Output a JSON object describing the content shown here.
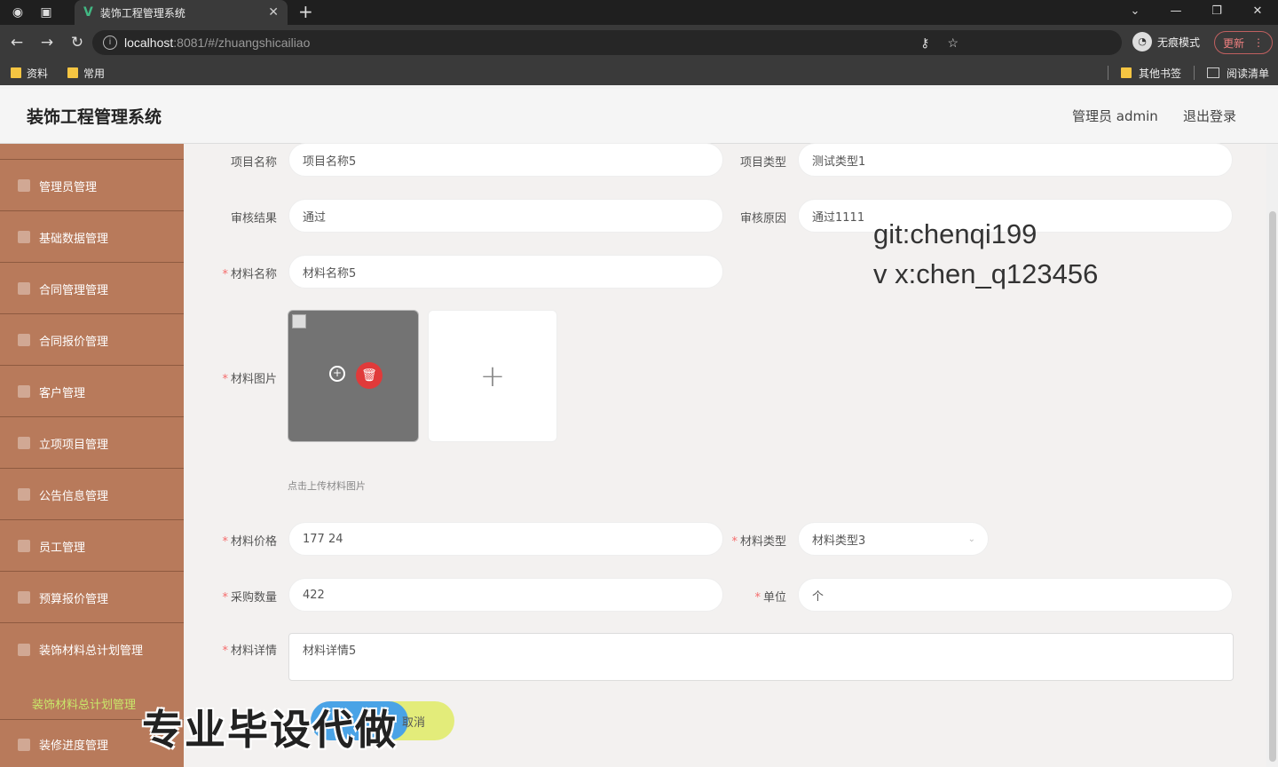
{
  "browser": {
    "tab_title": "装饰工程管理系统",
    "url_host": "localhost",
    "url_path": ":8081/#/zhuangshicailiao",
    "incognito_label": "无痕模式",
    "update_label": "更新",
    "bookmarks": [
      "资料",
      "常用"
    ],
    "bookmarks_right": [
      "其他书签",
      "阅读清单"
    ]
  },
  "header": {
    "title": "装饰工程管理系统",
    "user": "管理员 admin",
    "logout": "退出登录"
  },
  "sidebar": {
    "items": [
      {
        "label": "管理员管理"
      },
      {
        "label": "基础数据管理"
      },
      {
        "label": "合同管理管理"
      },
      {
        "label": "合同报价管理"
      },
      {
        "label": "客户管理"
      },
      {
        "label": "立项项目管理"
      },
      {
        "label": "公告信息管理"
      },
      {
        "label": "员工管理"
      },
      {
        "label": "预算报价管理"
      },
      {
        "label": "装饰材料总计划管理"
      }
    ],
    "active_sub": "装饰材料总计划管理",
    "last_item": "装修进度管理"
  },
  "form": {
    "project_name": {
      "label": "项目名称",
      "value": "项目名称5"
    },
    "project_type": {
      "label": "项目类型",
      "value": "测试类型1"
    },
    "review_result": {
      "label": "审核结果",
      "value": "通过"
    },
    "review_reason": {
      "label": "审核原因",
      "value": "通过1111"
    },
    "material_name": {
      "label": "材料名称",
      "value": "材料名称5"
    },
    "material_image": {
      "label": "材料图片",
      "hint": "点击上传材料图片"
    },
    "material_price": {
      "label": "材料价格",
      "value": "177 24"
    },
    "material_type": {
      "label": "材料类型",
      "value": "材料类型3"
    },
    "purchase_qty": {
      "label": "采购数量",
      "value": "422"
    },
    "unit": {
      "label": "单位",
      "value": "个"
    },
    "material_detail": {
      "label": "材料详情",
      "value": "材料详情5"
    },
    "cancel_label": "取消"
  },
  "watermarks": {
    "line1": "git:chenqi199",
    "line2": "v x:chen_q123456",
    "big": "专业毕设代做"
  }
}
